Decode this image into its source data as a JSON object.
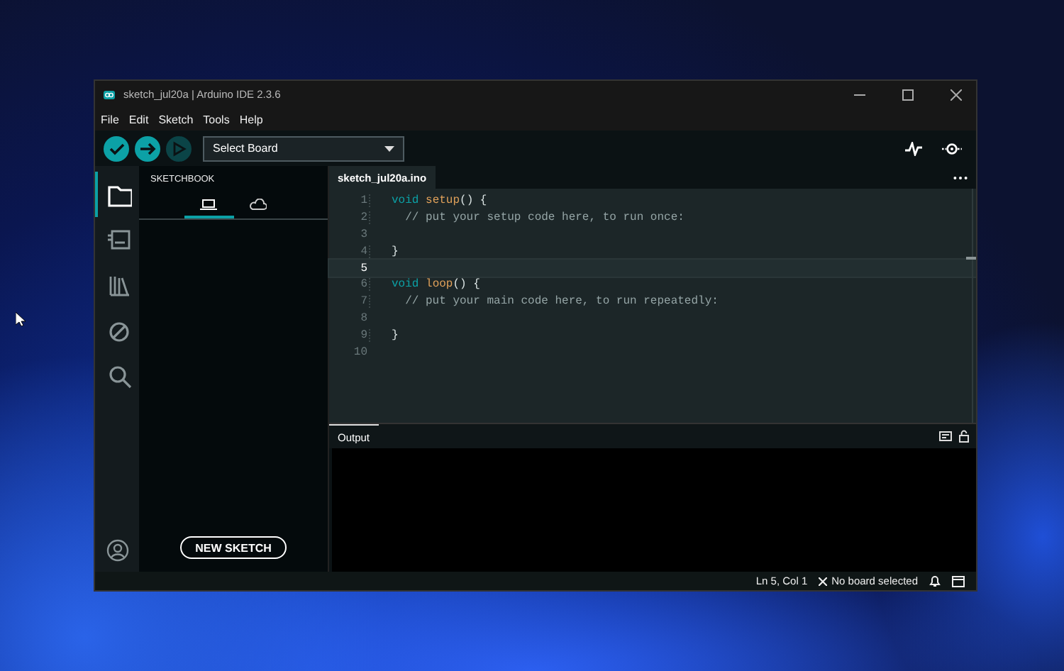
{
  "window": {
    "title": "sketch_jul20a | Arduino IDE 2.3.6"
  },
  "menu": [
    "File",
    "Edit",
    "Sketch",
    "Tools",
    "Help"
  ],
  "toolbar": {
    "buttons": [
      {
        "kind": "verify",
        "disabled": false
      },
      {
        "kind": "upload",
        "disabled": false
      },
      {
        "kind": "debug",
        "disabled": true
      }
    ],
    "board_select": {
      "value": "Select Board"
    }
  },
  "activity_bar": [
    {
      "kind": "sketchbook",
      "selected": true
    },
    {
      "kind": "boards",
      "selected": false
    },
    {
      "kind": "library",
      "selected": false
    },
    {
      "kind": "debug",
      "selected": false
    },
    {
      "kind": "search",
      "selected": false
    }
  ],
  "sidebar": {
    "title": "SKETCHBOOK",
    "tabs": [
      {
        "kind": "local",
        "selected": true
      },
      {
        "kind": "cloud",
        "selected": false
      }
    ],
    "button": "NEW SKETCH"
  },
  "editor": {
    "tabs": [
      {
        "label": "sketch_jul20a.ino",
        "selected": true
      }
    ],
    "lines": [
      {
        "number": "1",
        "current": false,
        "tokens": [
          {
            "kind": "keyword",
            "text": "void "
          },
          {
            "kind": "function",
            "text": "setup"
          },
          {
            "kind": "plain",
            "text": "() {"
          }
        ]
      },
      {
        "number": "2",
        "current": false,
        "tokens": [
          {
            "kind": "comment",
            "text": "  // put your setup code here, to run once:"
          }
        ]
      },
      {
        "number": "3",
        "current": false
      },
      {
        "number": "4",
        "current": false,
        "tokens": [
          {
            "kind": "plain",
            "text": "}"
          }
        ]
      },
      {
        "number": "5",
        "current": true
      },
      {
        "number": "6",
        "current": false,
        "tokens": [
          {
            "kind": "keyword",
            "text": "void "
          },
          {
            "kind": "function",
            "text": "loop"
          },
          {
            "kind": "plain",
            "text": "() {"
          }
        ]
      },
      {
        "number": "7",
        "current": false,
        "tokens": [
          {
            "kind": "comment",
            "text": "  // put your main code here, to run repeatedly:"
          }
        ]
      },
      {
        "number": "8",
        "current": false
      },
      {
        "number": "9",
        "current": false,
        "tokens": [
          {
            "kind": "plain",
            "text": "}"
          }
        ]
      },
      {
        "number": "10",
        "current": false
      }
    ]
  },
  "output": {
    "tabs": [
      {
        "label": "Output",
        "selected": true
      }
    ]
  },
  "status_bar": {
    "position": "Ln 5, Col 1",
    "board": "No board selected"
  }
}
